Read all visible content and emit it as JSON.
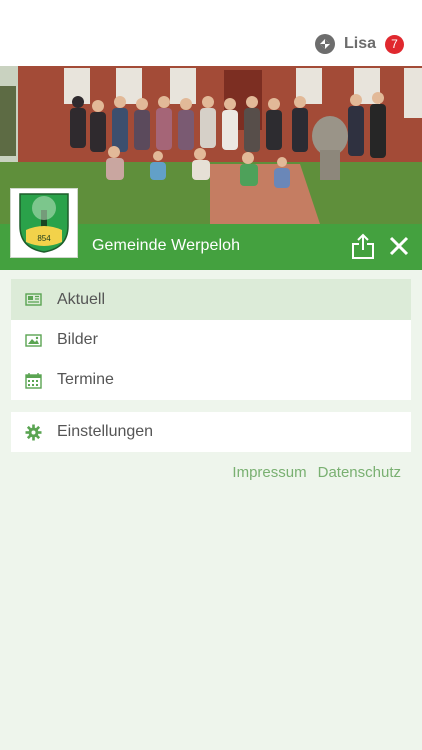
{
  "header": {
    "user_name": "Lisa",
    "notification_count": "7",
    "logo_icon": "app-logo-icon"
  },
  "banner": {
    "title": "Gemeinde Werpeloh",
    "crest_year": "854",
    "share_icon": "share-icon",
    "close_icon": "close-icon"
  },
  "menu": {
    "items": [
      {
        "label": "Aktuell",
        "icon": "newspaper-icon",
        "active": true
      },
      {
        "label": "Bilder",
        "icon": "image-icon",
        "active": false
      },
      {
        "label": "Termine",
        "icon": "calendar-icon",
        "active": false
      }
    ],
    "settings": {
      "label": "Einstellungen",
      "icon": "gear-icon"
    }
  },
  "footer": {
    "impressum": "Impressum",
    "datenschutz": "Datenschutz"
  },
  "colors": {
    "brand_green": "#44a13f",
    "active_bg": "#dcebd8",
    "background": "#eef5ec",
    "link": "#79b071",
    "badge": "#e0282e"
  }
}
